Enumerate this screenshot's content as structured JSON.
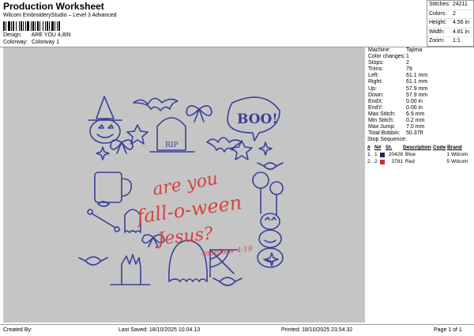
{
  "header": {
    "title": "Production Worksheet",
    "subtitle": "Wilcom EmbroideryStudio – Level 3 Advanced",
    "design_label": "Design:",
    "design_value": "ARE YOU 4,8IN",
    "colorway_label": "Colorway:",
    "colorway_value": "Colorway 1"
  },
  "summary": [
    {
      "label": "Stitches:",
      "value": "24211"
    },
    {
      "label": "Colors:",
      "value": "2"
    },
    {
      "label": "Height:",
      "value": "4.56 in"
    },
    {
      "label": "Width:",
      "value": "4.81 in"
    },
    {
      "label": "Zoom:",
      "value": "1:1"
    }
  ],
  "properties": [
    {
      "label": "Machine:",
      "value": "Tajima"
    },
    {
      "label": "Color changes:",
      "value": "1"
    },
    {
      "label": "Stops:",
      "value": "2"
    },
    {
      "label": "Trims:",
      "value": "79"
    },
    {
      "label": "Left:",
      "value": "61.1 mm"
    },
    {
      "label": "Right:",
      "value": "61.1 mm"
    },
    {
      "label": "Up:",
      "value": "57.9 mm"
    },
    {
      "label": "Down:",
      "value": "57.9 mm"
    },
    {
      "label": "EndX:",
      "value": "0.00 in"
    },
    {
      "label": "EndY:",
      "value": "0.00 in"
    },
    {
      "label": "Max Stitch:",
      "value": "6.9 mm"
    },
    {
      "label": "Min Stitch:",
      "value": "0.2 mm"
    },
    {
      "label": "Max Jump:",
      "value": "7.0 mm"
    },
    {
      "label": "Total Bobbin:",
      "value": "50.37ft"
    }
  ],
  "stop_sequence": {
    "title": "Stop Sequence:",
    "columns": [
      "#",
      "N#",
      "St.",
      "Description",
      "Code",
      "Brand"
    ],
    "rows": [
      {
        "num": "1.",
        "n": "1",
        "swatch": "#1f1f6e",
        "st": "20428",
        "desc": "Blue",
        "code": "1",
        "brand": "Wilcom"
      },
      {
        "num": "2.",
        "n": "2",
        "swatch": "#d42a2a",
        "st": "3781",
        "desc": "Red",
        "code": "5",
        "brand": "Wilcom"
      }
    ]
  },
  "design_art": {
    "line1": "are you",
    "line2": "fall-o-ween",
    "line3": "Jesus?",
    "line4": "-matthew 4:19",
    "rip": "RIP",
    "boo": "BOO!",
    "blue": "#3b3f9a",
    "red": "#d8423f"
  },
  "footer": {
    "created_by": "Created By:",
    "last_saved": "Last Saved: 18/10/2025 10.04.13",
    "printed": "Printed: 18/10/2025 23.54.32",
    "page": "Page 1 of 1"
  }
}
